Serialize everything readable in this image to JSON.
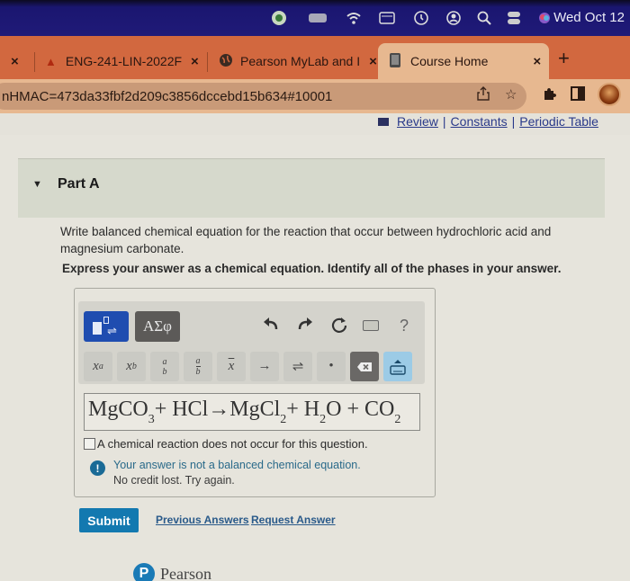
{
  "menubar": {
    "icons": [
      "app-icon",
      "battery-icon",
      "wifi-icon",
      "input-source-icon",
      "time-machine-icon",
      "user-icon",
      "spotlight-search-icon",
      "control-center-icon",
      "siri-icon"
    ],
    "date": "Wed Oct 12"
  },
  "tabs": [
    {
      "label": "",
      "close": "×"
    },
    {
      "label": "ENG-241-LIN-2022F",
      "close": "×"
    },
    {
      "label": "Pearson MyLab and I",
      "close": "×"
    },
    {
      "label": "Course Home",
      "close": "×",
      "active": true
    }
  ],
  "newtab_label": "+",
  "address": {
    "url": "nHMAC=473da33fbf2d209c3856dccebd15b634#10001"
  },
  "resources": {
    "review": "Review",
    "sep": "|",
    "constants": "Constants",
    "periodic_table": "Periodic Table"
  },
  "part": {
    "title": "Part A",
    "question": "Write balanced chemical equation for the reaction that occur between hydrochloric acid and magnesium carbonate.",
    "instruction": "Express your answer as a chemical equation. Identify all of the phases in your answer."
  },
  "toolbar": {
    "greek_label": "ΑΣφ",
    "undo": "↶",
    "redo": "↷",
    "reset": "↻",
    "help": "?",
    "keys": {
      "superscript": {
        "base": "x",
        "sup": "a"
      },
      "subscript": {
        "base": "x",
        "sub": "b"
      },
      "stack": {
        "top": "a",
        "bottom": "b"
      },
      "fraction": {
        "top": "a",
        "bottom": "b"
      },
      "overline": "x",
      "arrow": "→",
      "equilibrium": "⇌",
      "dot": "•",
      "delete": "⌫"
    }
  },
  "answer": {
    "parts": [
      {
        "t": "MgCO",
        "sub": "3"
      },
      {
        "t": " + HCl→MgCl",
        "sub": "2"
      },
      {
        "t": " + H",
        "sub": "2"
      },
      {
        "t": "O + CO",
        "sub": "2"
      }
    ],
    "no_reaction_label": "A chemical reaction does not occur for this question.",
    "no_reaction_checked": false
  },
  "feedback": {
    "icon": "!",
    "line1": "Your answer is not a balanced chemical equation.",
    "line2": "No credit lost. Try again."
  },
  "actions": {
    "submit": "Submit",
    "previous_answers": "Previous Answers",
    "request_answer": "Request Answer"
  },
  "footer": {
    "logo_letter": "P",
    "brand": "Pearson"
  },
  "colors": {
    "menubar": "#201a78",
    "tabbar": "#d2683f",
    "active_tab": "#e7b890",
    "submit": "#1379b0",
    "template_button": "#1f4db0",
    "feedback_text": "#2a6a8a"
  }
}
